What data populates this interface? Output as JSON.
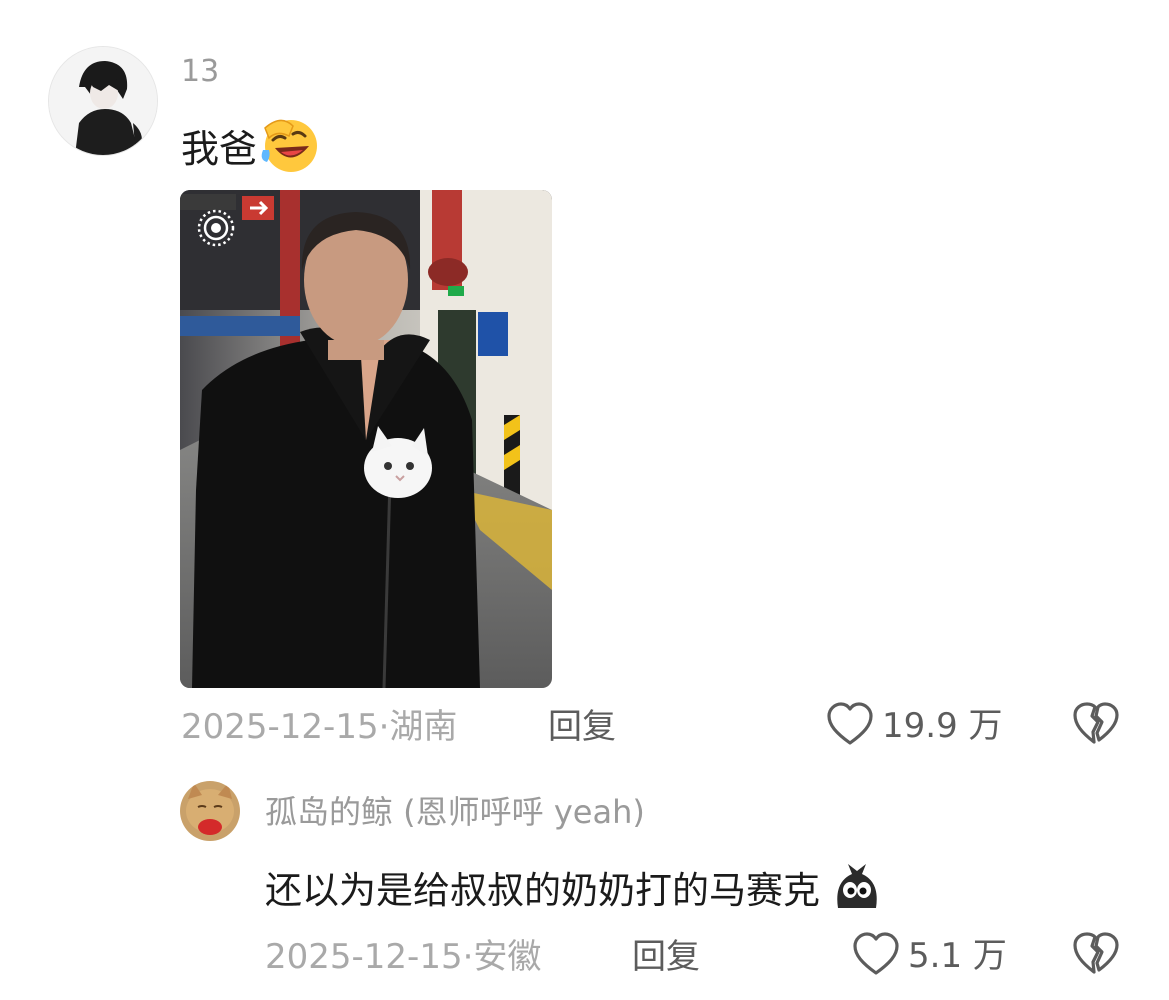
{
  "comment": {
    "username": "13",
    "text": "我爸",
    "emoji": "laughing-face-emoji",
    "image": "man-with-white-cat-in-jacket",
    "image_badge": "live-photo-icon",
    "date": "2025-12-15",
    "separator": "·",
    "location": "湖南",
    "reply_label": "回复",
    "likes": "19.9 万"
  },
  "reply": {
    "username": "孤岛的鲸 (恩师呼呼 yeah)",
    "text": "还以为是给叔叔的奶奶打的马赛克",
    "emoji": "black-blob-emoji",
    "date": "2025-12-15",
    "separator": "·",
    "location": "安徽",
    "reply_label": "回复",
    "likes": "5.1 万"
  },
  "colors": {
    "secondary_text": "#a9a9a9",
    "primary_text": "#1b1b1b",
    "action_text": "#5c5c5c"
  }
}
